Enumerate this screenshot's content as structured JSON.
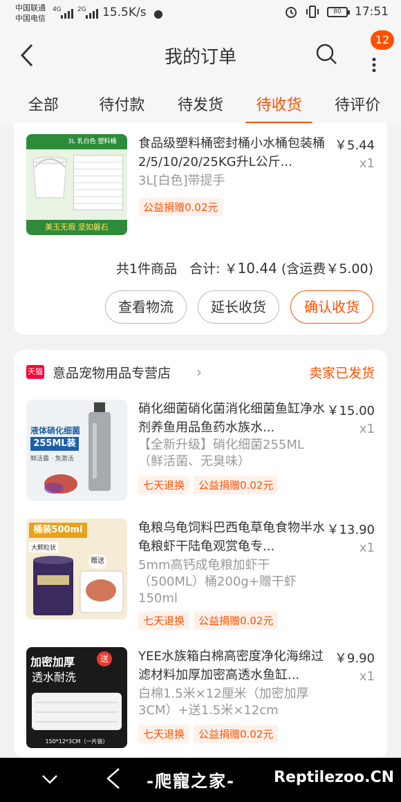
{
  "status_bar": {
    "carrier1": "中国联通",
    "carrier2": "中国电信",
    "net1": "4G",
    "net2": "2G",
    "speed": "15.5K/s",
    "battery": "80",
    "time": "17:51"
  },
  "header": {
    "title": "我的订单",
    "badge": "12"
  },
  "tabs": [
    {
      "label": "全部"
    },
    {
      "label": "待付款"
    },
    {
      "label": "待发货"
    },
    {
      "label": "待收货"
    },
    {
      "label": "待评价"
    }
  ],
  "active_tab": "待收货",
  "order1": {
    "item": {
      "title": "食品级塑料桶密封桶小水桶包装桶2/5/10/20/25KG升L公斤...",
      "spec": "3L[白色]带提手",
      "price": "￥5.44",
      "qty": "x1",
      "tag": "公益捐赠0.02元",
      "thumb_text": {
        "top": "3L 乳白色 塑料桶",
        "bottom": "美玉无瑕  坚如磐石"
      }
    },
    "summary": {
      "count": "共1件商品",
      "total_label": "合计: ",
      "currency": "￥",
      "total": "10.44",
      "shipping": "(含运费￥5.00)"
    },
    "buttons": {
      "logistics": "查看物流",
      "extend": "延长收货",
      "confirm": "确认收货"
    }
  },
  "order2": {
    "store": "意品宠物用品专营店",
    "store_badge": "天猫",
    "status": "卖家已发货",
    "items": [
      {
        "title": "硝化细菌硝化菌消化细菌鱼缸净水剂养鱼用品鱼药水族水...",
        "spec": "【全新升级】硝化细菌255ML（鲜活菌、无臭味）",
        "price": "￥15.00",
        "qty": "x1",
        "tags": [
          "七天退换",
          "公益捐赠0.02元"
        ],
        "thumb_text": {
          "line1": "液体硝化细菌",
          "line2": "255ML装",
          "line3": "鲜活菌 · 免激活"
        }
      },
      {
        "title": "龟粮乌龟饲料巴西龟草龟食物半水龟粮虾干陆龟观赏龟专...",
        "spec": "5mm高钙成龟粮加虾干（500ML）桶200g+赠干虾150ml",
        "price": "￥13.90",
        "qty": "x1",
        "tags": [
          "七天退换",
          "公益捐赠0.02元"
        ],
        "thumb_text": {
          "line1": "桶装500ml",
          "line2": "大颗粒状",
          "line3": "赠送"
        }
      },
      {
        "title": "YEE水族箱白棉高密度净化海绵过滤材料加厚加密高透水鱼缸...",
        "spec": "白棉1.5米×12厘米（加密加厚3CM）+送1.5米×12cm",
        "price": "￥9.90",
        "qty": "x1",
        "tags": [
          "七天退换",
          "公益捐赠0.02元"
        ],
        "thumb_text": {
          "line1": "加密加厚",
          "line2": "透水耐洗",
          "line3": "150*12*3CM（一片装）",
          "badge": "送"
        }
      }
    ]
  },
  "watermark": {
    "cn": "-爬寵之家-",
    "url": "Reptilezoo.CN"
  },
  "colors": {
    "accent": "#ff5000",
    "background": "#f2f2f2",
    "nav": "#000000"
  }
}
